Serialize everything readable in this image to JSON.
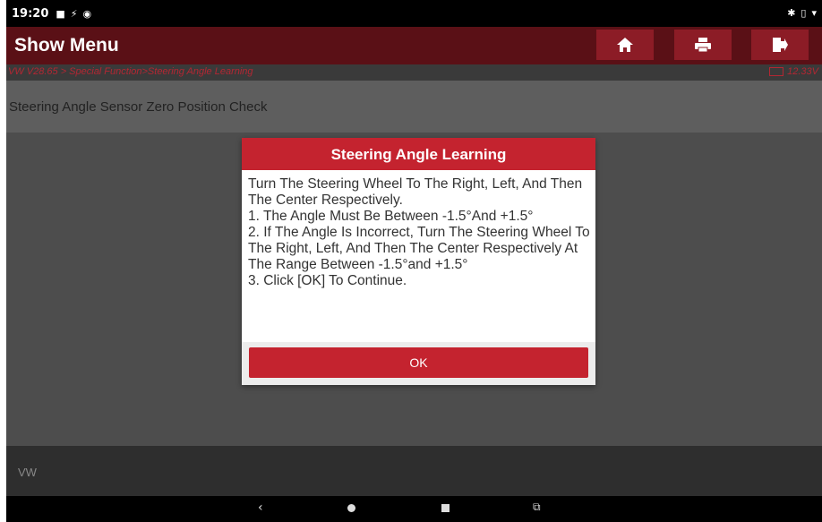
{
  "status_bar": {
    "time": "19:20",
    "icons_left": [
      "notification-icon",
      "usb-icon",
      "screen-record-icon"
    ],
    "icons_right": [
      "bluetooth-icon",
      "vibrate-icon",
      "wifi-icon"
    ]
  },
  "header": {
    "title": "Show Menu",
    "buttons": [
      "home",
      "print",
      "exit"
    ]
  },
  "breadcrumb": {
    "path": "VW V28.65 > Special Function>Steering Angle Learning",
    "voltage": "12.33V"
  },
  "main": {
    "title": "Steering Angle Sensor Zero Position Check"
  },
  "dialog": {
    "title": "Steering Angle Learning",
    "message": "Turn The Steering Wheel To The Right, Left, And Then The Center Respectively.\n 1. The Angle Must Be Between -1.5°And +1.5°\n 2. If The Angle Is Incorrect, Turn The Steering Wheel To The Right, Left, And Then The Center Respectively At The Range Between -1.5°and +1.5°\n 3. Click [OK] To Continue.",
    "ok_label": "OK"
  },
  "footer": {
    "label": "VW"
  },
  "colors": {
    "accent": "#c4232f",
    "header_bg": "#5a1016",
    "overlay_bg": "#4d4d4d"
  }
}
